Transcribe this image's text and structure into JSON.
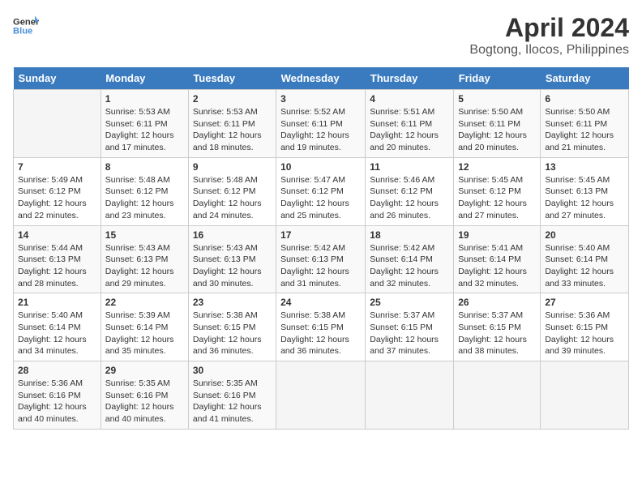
{
  "header": {
    "logo_line1": "General",
    "logo_line2": "Blue",
    "title": "April 2024",
    "subtitle": "Bogtong, Ilocos, Philippines"
  },
  "calendar": {
    "days_of_week": [
      "Sunday",
      "Monday",
      "Tuesday",
      "Wednesday",
      "Thursday",
      "Friday",
      "Saturday"
    ],
    "weeks": [
      [
        {
          "day": "",
          "info": ""
        },
        {
          "day": "1",
          "info": "Sunrise: 5:53 AM\nSunset: 6:11 PM\nDaylight: 12 hours\nand 17 minutes."
        },
        {
          "day": "2",
          "info": "Sunrise: 5:53 AM\nSunset: 6:11 PM\nDaylight: 12 hours\nand 18 minutes."
        },
        {
          "day": "3",
          "info": "Sunrise: 5:52 AM\nSunset: 6:11 PM\nDaylight: 12 hours\nand 19 minutes."
        },
        {
          "day": "4",
          "info": "Sunrise: 5:51 AM\nSunset: 6:11 PM\nDaylight: 12 hours\nand 20 minutes."
        },
        {
          "day": "5",
          "info": "Sunrise: 5:50 AM\nSunset: 6:11 PM\nDaylight: 12 hours\nand 20 minutes."
        },
        {
          "day": "6",
          "info": "Sunrise: 5:50 AM\nSunset: 6:11 PM\nDaylight: 12 hours\nand 21 minutes."
        }
      ],
      [
        {
          "day": "7",
          "info": "Sunrise: 5:49 AM\nSunset: 6:12 PM\nDaylight: 12 hours\nand 22 minutes."
        },
        {
          "day": "8",
          "info": "Sunrise: 5:48 AM\nSunset: 6:12 PM\nDaylight: 12 hours\nand 23 minutes."
        },
        {
          "day": "9",
          "info": "Sunrise: 5:48 AM\nSunset: 6:12 PM\nDaylight: 12 hours\nand 24 minutes."
        },
        {
          "day": "10",
          "info": "Sunrise: 5:47 AM\nSunset: 6:12 PM\nDaylight: 12 hours\nand 25 minutes."
        },
        {
          "day": "11",
          "info": "Sunrise: 5:46 AM\nSunset: 6:12 PM\nDaylight: 12 hours\nand 26 minutes."
        },
        {
          "day": "12",
          "info": "Sunrise: 5:45 AM\nSunset: 6:12 PM\nDaylight: 12 hours\nand 27 minutes."
        },
        {
          "day": "13",
          "info": "Sunrise: 5:45 AM\nSunset: 6:13 PM\nDaylight: 12 hours\nand 27 minutes."
        }
      ],
      [
        {
          "day": "14",
          "info": "Sunrise: 5:44 AM\nSunset: 6:13 PM\nDaylight: 12 hours\nand 28 minutes."
        },
        {
          "day": "15",
          "info": "Sunrise: 5:43 AM\nSunset: 6:13 PM\nDaylight: 12 hours\nand 29 minutes."
        },
        {
          "day": "16",
          "info": "Sunrise: 5:43 AM\nSunset: 6:13 PM\nDaylight: 12 hours\nand 30 minutes."
        },
        {
          "day": "17",
          "info": "Sunrise: 5:42 AM\nSunset: 6:13 PM\nDaylight: 12 hours\nand 31 minutes."
        },
        {
          "day": "18",
          "info": "Sunrise: 5:42 AM\nSunset: 6:14 PM\nDaylight: 12 hours\nand 32 minutes."
        },
        {
          "day": "19",
          "info": "Sunrise: 5:41 AM\nSunset: 6:14 PM\nDaylight: 12 hours\nand 32 minutes."
        },
        {
          "day": "20",
          "info": "Sunrise: 5:40 AM\nSunset: 6:14 PM\nDaylight: 12 hours\nand 33 minutes."
        }
      ],
      [
        {
          "day": "21",
          "info": "Sunrise: 5:40 AM\nSunset: 6:14 PM\nDaylight: 12 hours\nand 34 minutes."
        },
        {
          "day": "22",
          "info": "Sunrise: 5:39 AM\nSunset: 6:14 PM\nDaylight: 12 hours\nand 35 minutes."
        },
        {
          "day": "23",
          "info": "Sunrise: 5:38 AM\nSunset: 6:15 PM\nDaylight: 12 hours\nand 36 minutes."
        },
        {
          "day": "24",
          "info": "Sunrise: 5:38 AM\nSunset: 6:15 PM\nDaylight: 12 hours\nand 36 minutes."
        },
        {
          "day": "25",
          "info": "Sunrise: 5:37 AM\nSunset: 6:15 PM\nDaylight: 12 hours\nand 37 minutes."
        },
        {
          "day": "26",
          "info": "Sunrise: 5:37 AM\nSunset: 6:15 PM\nDaylight: 12 hours\nand 38 minutes."
        },
        {
          "day": "27",
          "info": "Sunrise: 5:36 AM\nSunset: 6:15 PM\nDaylight: 12 hours\nand 39 minutes."
        }
      ],
      [
        {
          "day": "28",
          "info": "Sunrise: 5:36 AM\nSunset: 6:16 PM\nDaylight: 12 hours\nand 40 minutes."
        },
        {
          "day": "29",
          "info": "Sunrise: 5:35 AM\nSunset: 6:16 PM\nDaylight: 12 hours\nand 40 minutes."
        },
        {
          "day": "30",
          "info": "Sunrise: 5:35 AM\nSunset: 6:16 PM\nDaylight: 12 hours\nand 41 minutes."
        },
        {
          "day": "",
          "info": ""
        },
        {
          "day": "",
          "info": ""
        },
        {
          "day": "",
          "info": ""
        },
        {
          "day": "",
          "info": ""
        }
      ]
    ]
  }
}
